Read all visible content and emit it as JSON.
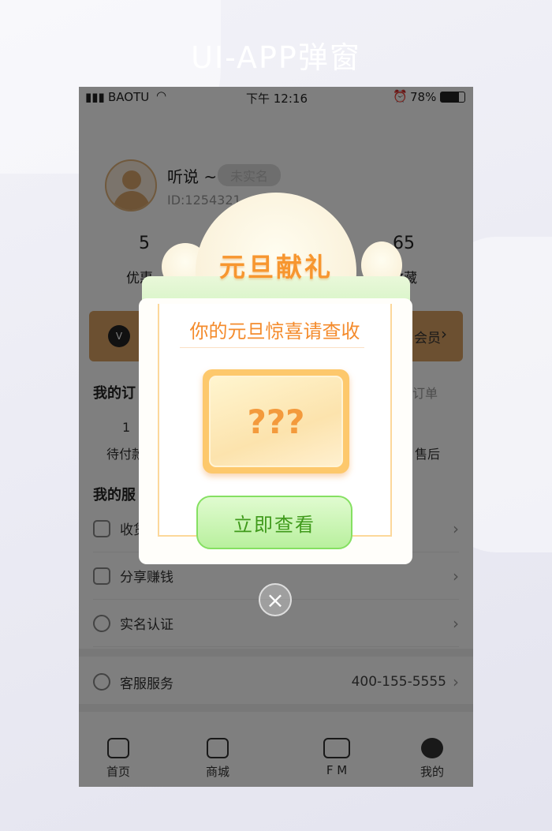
{
  "headline": "UI-APP弹窗",
  "status": {
    "carrier": "BAOTU",
    "time": "下午 12:16",
    "battery": "78%"
  },
  "profile": {
    "name": "听说 ~",
    "badge": "未实名",
    "id": "ID:1254321"
  },
  "stats": [
    {
      "value": "5",
      "label": "优惠"
    },
    {
      "value": "65",
      "label": "收藏"
    }
  ],
  "vip": {
    "icon": "vip-icon",
    "action": "会员"
  },
  "orders": {
    "title": "我的订",
    "link": "订单",
    "items": [
      {
        "value": "1",
        "label": "待付款"
      },
      {
        "label": "售后"
      }
    ]
  },
  "services": {
    "title": "我的服",
    "items": [
      {
        "label": "收货",
        "icon": "location-icon"
      },
      {
        "label": "分享赚钱",
        "icon": "share-icon"
      },
      {
        "label": "实名认证",
        "icon": "user-check-icon"
      }
    ]
  },
  "support": {
    "label": "客服服务",
    "phone": "400-155-5555"
  },
  "tabs": [
    {
      "label": "首页"
    },
    {
      "label": "商城"
    },
    {
      "label": "F M"
    },
    {
      "label": "我的"
    }
  ],
  "modal": {
    "title": "元旦献礼",
    "subtitle": "你的元旦惊喜请查收",
    "card_text": "???",
    "button": "立即查看",
    "close": "×"
  },
  "colors": {
    "accent_orange": "#f7962f",
    "button_green": "#b9f09e",
    "overlay": "rgba(0,0,0,0.5)"
  }
}
